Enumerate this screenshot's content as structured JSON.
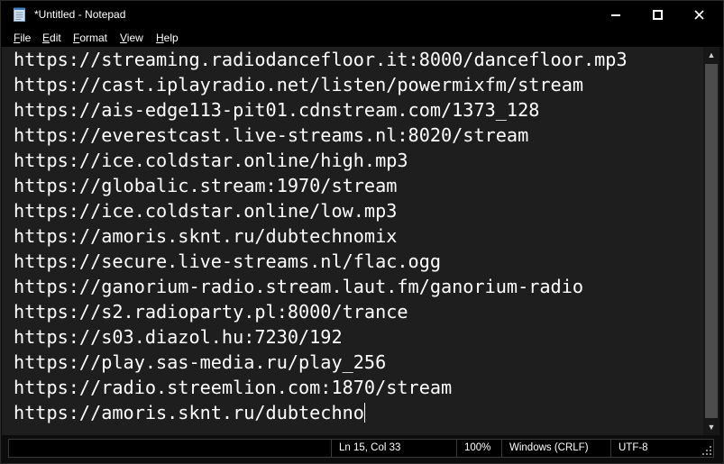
{
  "window": {
    "title": "*Untitled - Notepad"
  },
  "controls": {
    "minimize_glyph": "—",
    "maximize_glyph": "☐",
    "close_glyph": "✕"
  },
  "menu": {
    "file": "File",
    "edit": "Edit",
    "format": "Format",
    "view": "View",
    "help": "Help"
  },
  "editor": {
    "lines": [
      "https://streaming.radiodancefloor.it:8000/dancefloor.mp3",
      "https://cast.iplayradio.net/listen/powermixfm/stream",
      "https://ais-edge113-pit01.cdnstream.com/1373_128",
      "https://everestcast.live-streams.nl:8020/stream",
      "https://ice.coldstar.online/high.mp3",
      "https://globalic.stream:1970/stream",
      "https://ice.coldstar.online/low.mp3",
      "https://amoris.sknt.ru/dubtechnomix",
      "https://secure.live-streams.nl/flac.ogg",
      "https://ganorium-radio.stream.laut.fm/ganorium-radio",
      "https://s2.radioparty.pl:8000/trance",
      "https://s03.diazol.hu:7230/192",
      "https://play.sas-media.ru/play_256",
      "https://radio.streemlion.com:1870/stream",
      "https://amoris.sknt.ru/dubtechno"
    ]
  },
  "scrollbar": {
    "up_glyph": "▲",
    "down_glyph": "▼"
  },
  "status": {
    "position": "Ln 15, Col 33",
    "zoom": "100%",
    "line_endings": "Windows (CRLF)",
    "encoding": "UTF-8"
  }
}
